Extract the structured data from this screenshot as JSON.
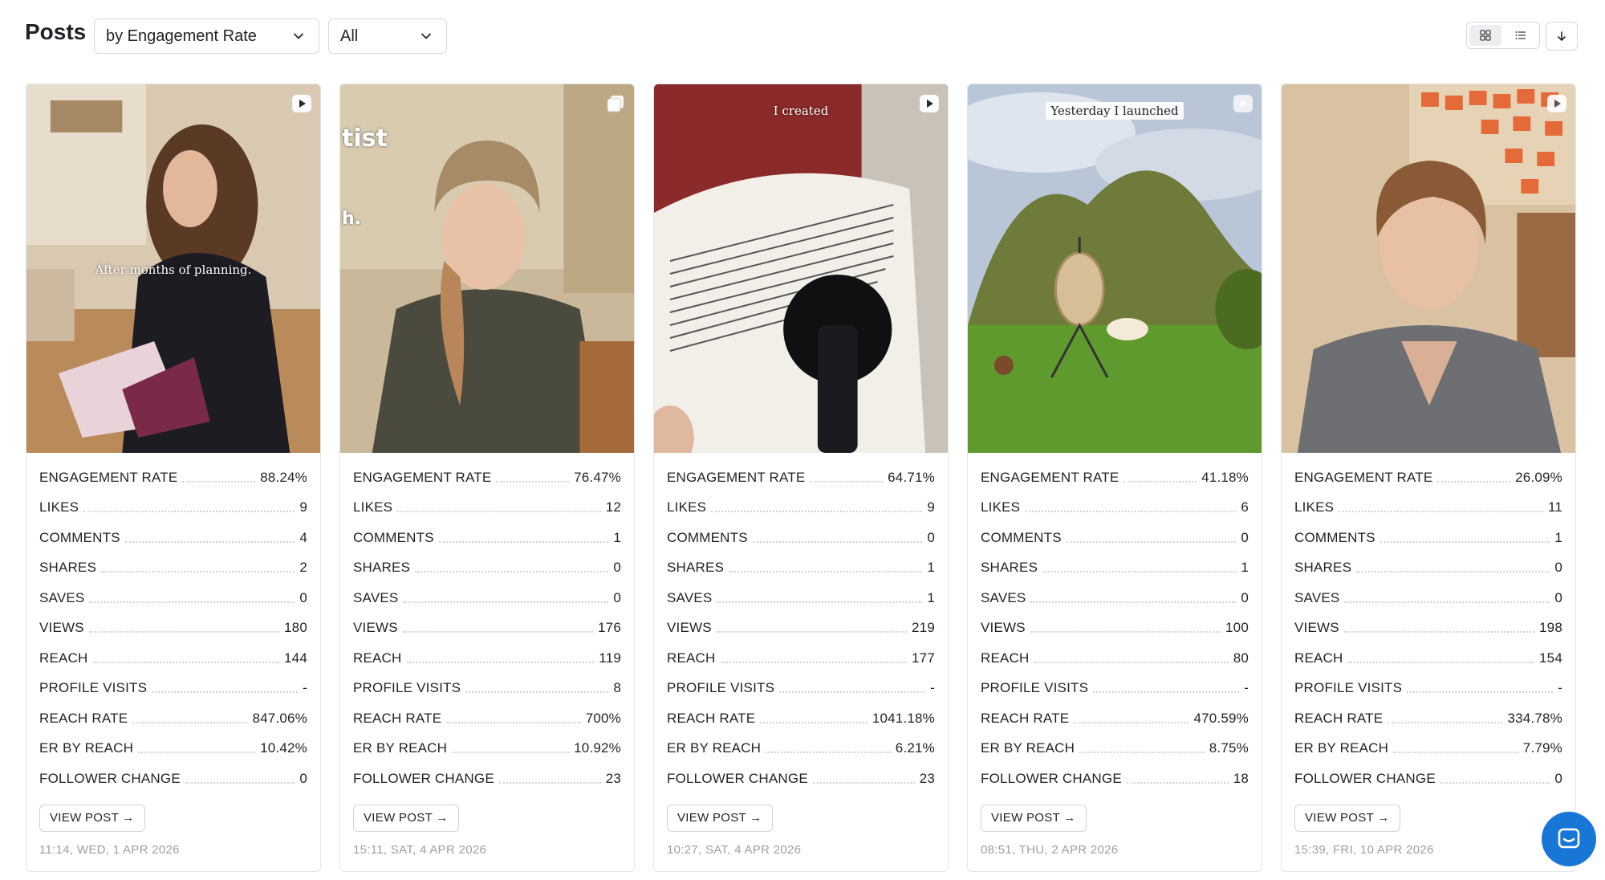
{
  "header": {
    "title": "Posts",
    "sort_select": {
      "value": "by Engagement Rate",
      "icon": "chevron-down-icon"
    },
    "filter_select": {
      "value": "All",
      "icon": "chevron-down-icon"
    },
    "view_toggle": {
      "grid_icon": "grid-icon",
      "list_icon": "list-icon",
      "active": "grid"
    },
    "sort_direction_icon": "arrow-down-icon"
  },
  "metric_labels": [
    "ENGAGEMENT RATE",
    "LIKES",
    "COMMENTS",
    "SHARES",
    "SAVES",
    "VIEWS",
    "REACH",
    "PROFILE VISITS",
    "REACH RATE",
    "ER BY REACH",
    "FOLLOWER CHANGE"
  ],
  "posts": [
    {
      "thumbnail_caption": "After months of planning.",
      "media_icon": "video-play-icon",
      "metrics": [
        "88.24%",
        "9",
        "4",
        "2",
        "0",
        "180",
        "144",
        "-",
        "847.06%",
        "10.42%",
        "0"
      ],
      "view_post_label": "VIEW POST →",
      "timestamp": "11:14, WED, 1 APR 2026"
    },
    {
      "thumbnail_caption": "tist",
      "thumbnail_caption_2": "h.",
      "media_icon": "carousel-icon",
      "metrics": [
        "76.47%",
        "12",
        "1",
        "0",
        "0",
        "176",
        "119",
        "8",
        "700%",
        "10.92%",
        "23"
      ],
      "view_post_label": "VIEW POST →",
      "timestamp": "15:11, SAT, 4 APR 2026"
    },
    {
      "thumbnail_caption": "I created",
      "media_icon": "video-play-icon",
      "metrics": [
        "64.71%",
        "9",
        "0",
        "1",
        "1",
        "219",
        "177",
        "-",
        "1041.18%",
        "6.21%",
        "23"
      ],
      "view_post_label": "VIEW POST →",
      "timestamp": "10:27, SAT, 4 APR 2026"
    },
    {
      "thumbnail_caption": "Yesterday I launched",
      "media_icon": "video-play-icon",
      "metrics": [
        "41.18%",
        "6",
        "0",
        "1",
        "0",
        "100",
        "80",
        "-",
        "470.59%",
        "8.75%",
        "18"
      ],
      "view_post_label": "VIEW POST →",
      "timestamp": "08:51, THU, 2 APR 2026"
    },
    {
      "thumbnail_caption": "",
      "media_icon": "video-play-icon",
      "metrics": [
        "26.09%",
        "11",
        "1",
        "0",
        "0",
        "198",
        "154",
        "-",
        "334.78%",
        "7.79%",
        "0"
      ],
      "view_post_label": "VIEW POST →",
      "timestamp": "15:39, FRI, 10 APR 2026"
    }
  ],
  "chat_widget": {
    "icon": "chat-bubble-icon",
    "color": "#1877d6"
  }
}
